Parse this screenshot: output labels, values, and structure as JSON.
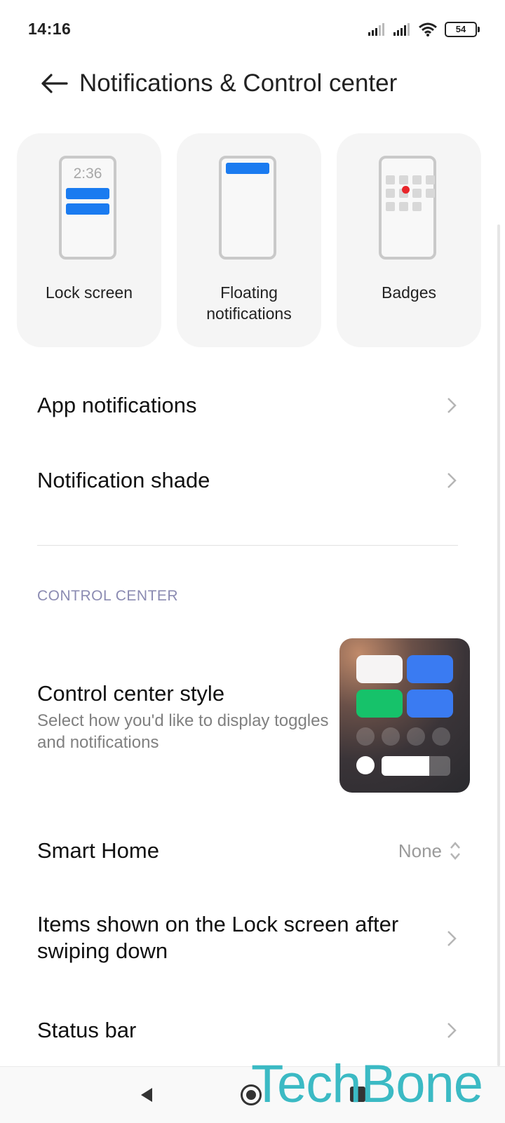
{
  "status_bar": {
    "time": "14:16",
    "battery": "54"
  },
  "header": {
    "title": "Notifications & Control center"
  },
  "cards": [
    {
      "label": "Lock screen",
      "clock": "2:36"
    },
    {
      "label": "Floating notifications"
    },
    {
      "label": "Badges"
    }
  ],
  "list": {
    "app_notifications": "App notifications",
    "notification_shade": "Notification shade"
  },
  "control_center": {
    "section_label": "CONTROL CENTER",
    "style_title": "Control center style",
    "style_subtitle": "Select how you'd like to display toggles and notifications",
    "smart_home_title": "Smart Home",
    "smart_home_value": "None",
    "lock_items_title": "Items shown on the Lock screen after swiping down",
    "status_bar_title": "Status bar"
  },
  "watermark": "TechBone",
  "colors": {
    "accent_blue": "#1a7bf0",
    "badge_red": "#e8262b",
    "section_label": "#8b8bb2",
    "watermark": "#3bbac4"
  }
}
